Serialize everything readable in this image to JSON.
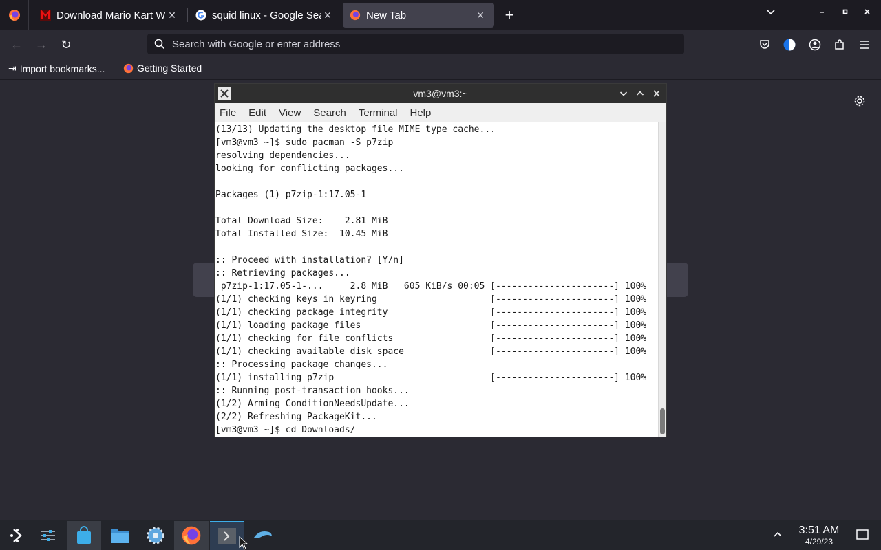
{
  "browser": {
    "tabs": [
      {
        "title": "Download Mario Kart Wii",
        "icon": "red-m-favicon",
        "active": false
      },
      {
        "title": "squid linux - Google Search",
        "icon": "google-favicon",
        "active": false
      },
      {
        "title": "New Tab",
        "icon": "firefox-favicon",
        "active": true
      }
    ],
    "url_placeholder": "Search with Google or enter address",
    "bookmarks": [
      {
        "label": "Import bookmarks...",
        "icon": "import-icon"
      },
      {
        "label": "Getting Started",
        "icon": "firefox-icon"
      }
    ]
  },
  "terminal": {
    "title": "vm3@vm3:~",
    "menu": [
      "File",
      "Edit",
      "View",
      "Search",
      "Terminal",
      "Help"
    ],
    "lines": [
      "(13/13) Updating the desktop file MIME type cache...",
      "[vm3@vm3 ~]$ sudo pacman -S p7zip",
      "resolving dependencies...",
      "looking for conflicting packages...",
      "",
      "Packages (1) p7zip-1:17.05-1",
      "",
      "Total Download Size:    2.81 MiB",
      "Total Installed Size:  10.45 MiB",
      "",
      ":: Proceed with installation? [Y/n]",
      ":: Retrieving packages...",
      " p7zip-1:17.05-1-...     2.8 MiB   605 KiB/s 00:05 [----------------------] 100%",
      "(1/1) checking keys in keyring                     [----------------------] 100%",
      "(1/1) checking package integrity                   [----------------------] 100%",
      "(1/1) loading package files                        [----------------------] 100%",
      "(1/1) checking for file conflicts                  [----------------------] 100%",
      "(1/1) checking available disk space                [----------------------] 100%",
      ":: Processing package changes...",
      "(1/1) installing p7zip                             [----------------------] 100%",
      ":: Running post-transaction hooks...",
      "(1/2) Arming ConditionNeedsUpdate...",
      "(2/2) Refreshing PackageKit...",
      "[vm3@vm3 ~]$ cd Downloads/"
    ]
  },
  "taskbar": {
    "clock_time": "3:51 AM",
    "clock_date": "4/29/23"
  },
  "colors": {
    "accent": "#3daee9",
    "browser_bg": "#2b2a33",
    "tabbar_bg": "#1c1b22",
    "terminal_bg": "#ffffff"
  }
}
